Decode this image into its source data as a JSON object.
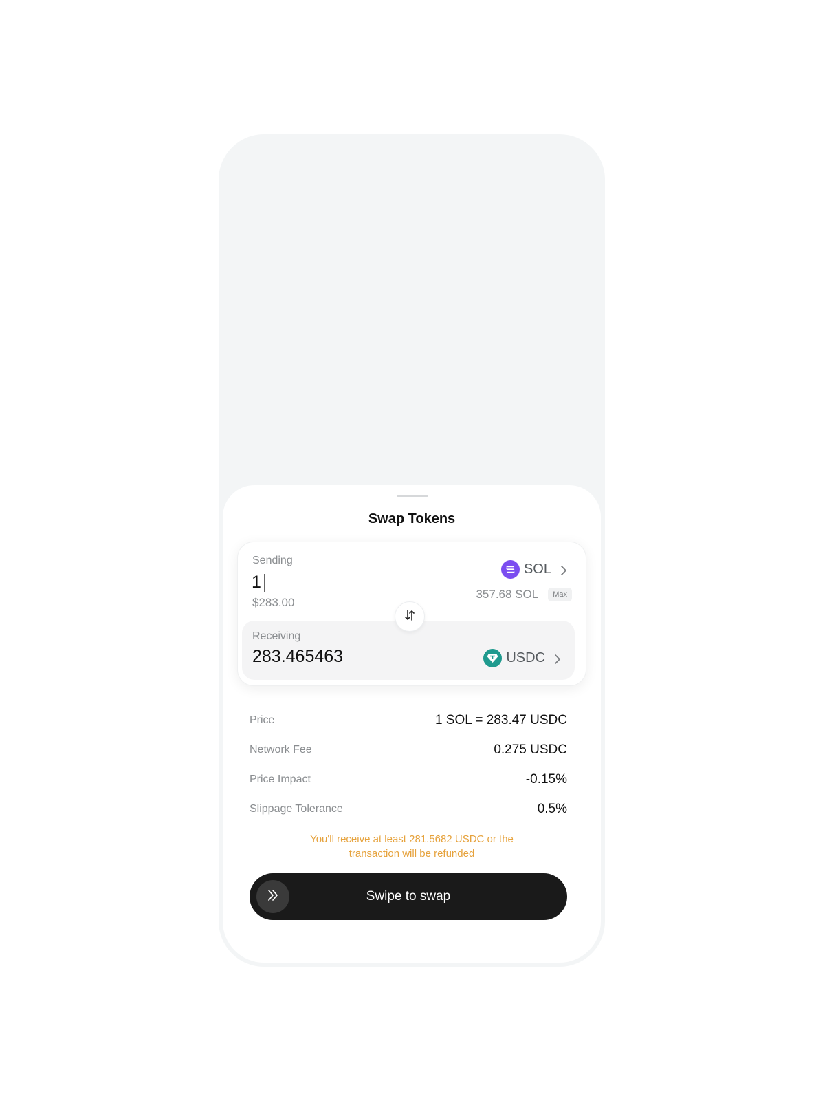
{
  "sheet": {
    "title": "Swap Tokens"
  },
  "sending": {
    "label": "Sending",
    "amount": "1",
    "usd_value": "$283.00",
    "token": "SOL",
    "token_icon": "solana-icon",
    "balance": "357.68 SOL",
    "max_label": "Max"
  },
  "receiving": {
    "label": "Receiving",
    "amount": "283.465463",
    "token": "USDC",
    "token_icon": "usdc-icon"
  },
  "details": [
    {
      "label": "Price",
      "value": "1 SOL = 283.47 USDC"
    },
    {
      "label": "Network Fee",
      "value": "0.275 USDC"
    },
    {
      "label": "Price Impact",
      "value": "-0.15%"
    },
    {
      "label": "Slippage Tolerance",
      "value": "0.5%"
    }
  ],
  "warning": "You'll receive at least 281.5682 USDC or the transaction will be refunded",
  "swipe": {
    "label": "Swipe to swap"
  },
  "colors": {
    "sol": "#7b4df0",
    "usdc": "#1f9a8e",
    "warning": "#e6a23c",
    "button": "#1a1a1a"
  }
}
